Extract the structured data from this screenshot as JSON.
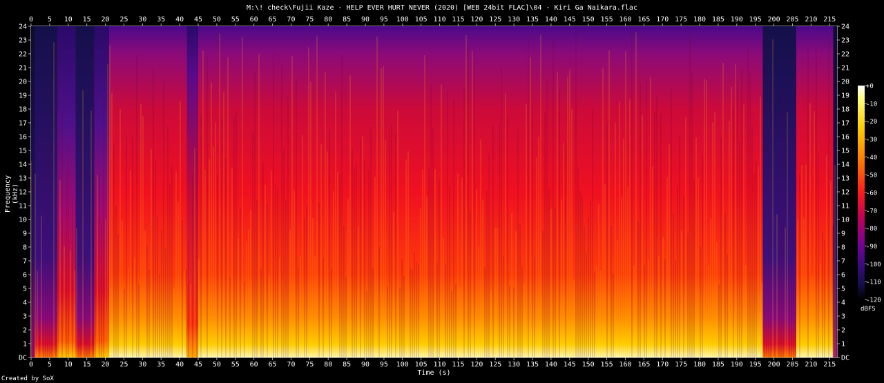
{
  "title": "M:\\! check\\Fujii Kaze - HELP EVER HURT NEVER (2020) [WEB 24bit FLAC]\\04 - Kiri Ga Naikara.flac",
  "credit": "Created by SoX",
  "chart_data": {
    "type": "heatmap",
    "title": "M:\\! check\\Fujii Kaze - HELP EVER HURT NEVER (2020) [WEB 24bit FLAC]\\04 - Kiri Ga Naikara.flac",
    "xlabel": "Time (s)",
    "ylabel": "Frequency (kHz)",
    "xlim": [
      0,
      217
    ],
    "ylim": [
      0,
      24
    ],
    "x_ticks": [
      0,
      5,
      10,
      15,
      20,
      25,
      30,
      35,
      40,
      45,
      50,
      55,
      60,
      65,
      70,
      75,
      80,
      85,
      90,
      95,
      100,
      105,
      110,
      115,
      120,
      125,
      130,
      135,
      140,
      145,
      150,
      155,
      160,
      165,
      170,
      175,
      180,
      185,
      190,
      195,
      200,
      205,
      210,
      215
    ],
    "y_ticks": [
      "DC",
      "1",
      "2",
      "3",
      "4",
      "5",
      "6",
      "7",
      "8",
      "9",
      "10",
      "11",
      "12",
      "13",
      "14",
      "15",
      "16",
      "17",
      "18",
      "19",
      "20",
      "21",
      "22",
      "23",
      "24"
    ],
    "colorbar": {
      "label": "dBFS",
      "ticks": [
        "+0",
        "-10",
        "-20",
        "-30",
        "-40",
        "-50",
        "-60",
        "-70",
        "-80",
        "-90",
        "-100",
        "-110",
        "-120"
      ],
      "range": [
        -120,
        0
      ]
    },
    "sections": [
      {
        "start": 0,
        "end": 1,
        "level": "quiet"
      },
      {
        "start": 1,
        "end": 7,
        "level": "low"
      },
      {
        "start": 7,
        "end": 12,
        "level": "low-mid"
      },
      {
        "start": 12,
        "end": 17,
        "level": "low"
      },
      {
        "start": 17,
        "end": 21,
        "level": "low-mid"
      },
      {
        "start": 21,
        "end": 42,
        "level": "full"
      },
      {
        "start": 42,
        "end": 45,
        "level": "dip"
      },
      {
        "start": 45,
        "end": 197,
        "level": "full"
      },
      {
        "start": 197,
        "end": 206,
        "level": "low"
      },
      {
        "start": 206,
        "end": 216,
        "level": "full"
      },
      {
        "start": 216,
        "end": 217,
        "level": "quiet"
      }
    ]
  }
}
